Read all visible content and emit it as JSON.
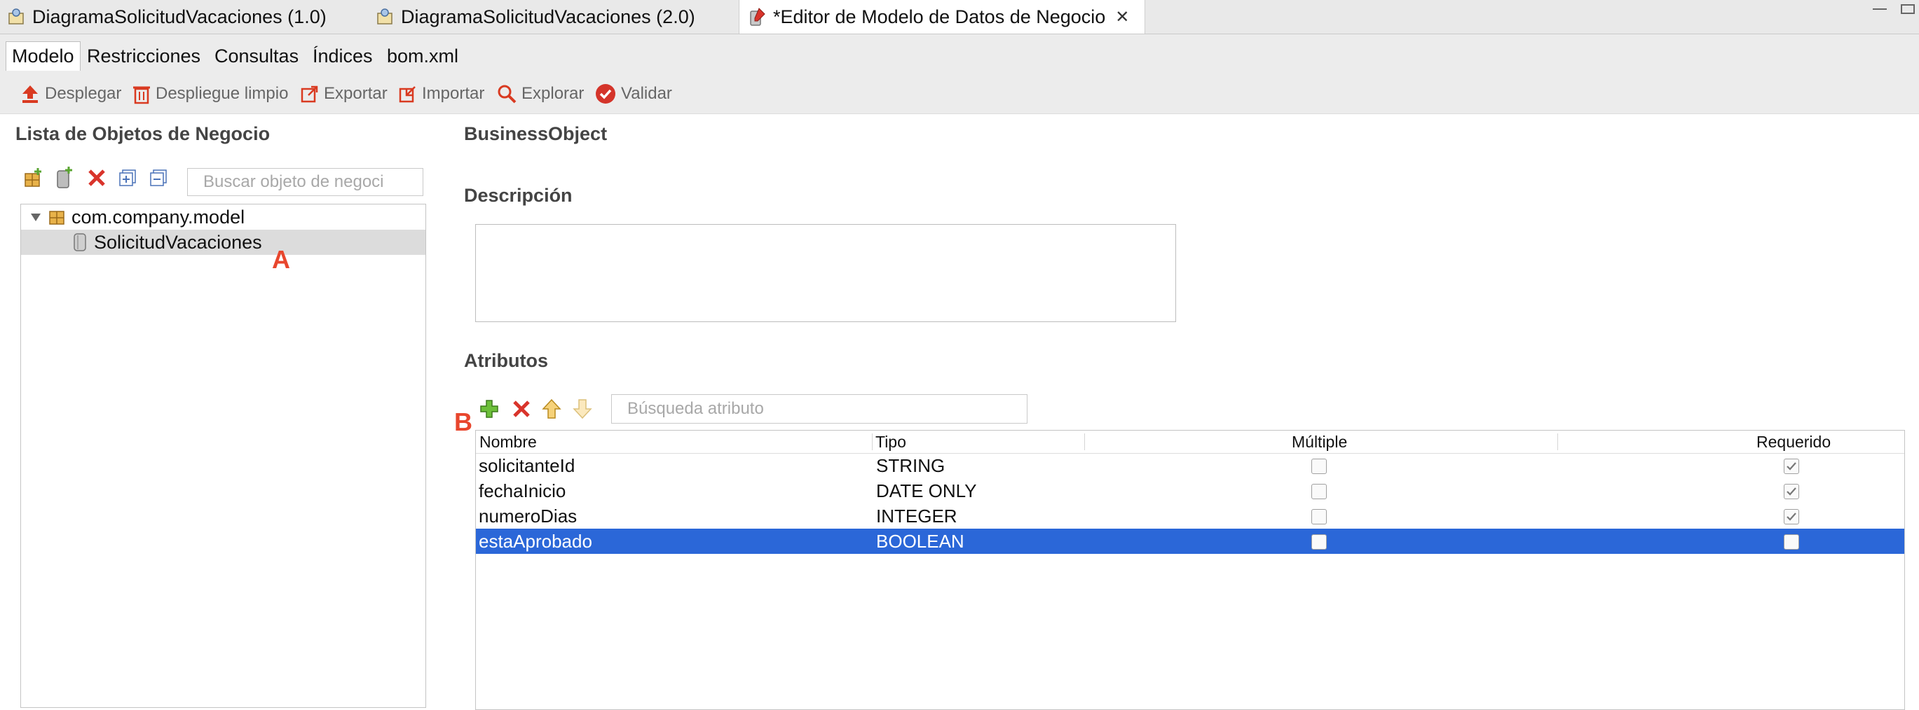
{
  "editor_tabs": [
    {
      "label": "DiagramaSolicitudVacaciones (1.0)"
    },
    {
      "label": "DiagramaSolicitudVacaciones (2.0)"
    },
    {
      "label": "*Editor de Modelo de Datos de Negocio"
    }
  ],
  "page_tabs": [
    {
      "label": "Modelo"
    },
    {
      "label": "Restricciones"
    },
    {
      "label": "Consultas"
    },
    {
      "label": "Índices"
    },
    {
      "label": "bom.xml"
    }
  ],
  "toolbar": {
    "deploy": "Desplegar",
    "clean_deploy": "Despliegue limpio",
    "export": "Exportar",
    "import": "Importar",
    "explore": "Explorar",
    "validate": "Validar"
  },
  "left_panel": {
    "title": "Lista de Objetos de Negocio",
    "search_placeholder": "Buscar objeto de negoci",
    "tree": {
      "package": "com.company.model",
      "object": "SolicitudVacaciones"
    },
    "marker": "A"
  },
  "right_panel": {
    "object_title": "BusinessObject",
    "description_label": "Descripción",
    "description_value": "",
    "attributes_label": "Atributos",
    "attr_search_placeholder": "Búsqueda atributo",
    "marker": "B",
    "table": {
      "headers": {
        "name": "Nombre",
        "type": "Tipo",
        "multiple": "Múltiple",
        "required": "Requerido"
      },
      "rows": [
        {
          "name": "solicitanteId",
          "type": "STRING",
          "multiple": false,
          "required": true
        },
        {
          "name": "fechaInicio",
          "type": "DATE ONLY",
          "multiple": false,
          "required": true
        },
        {
          "name": "numeroDias",
          "type": "INTEGER",
          "multiple": false,
          "required": true
        },
        {
          "name": "estaAprobado",
          "type": "BOOLEAN",
          "multiple": false,
          "required": false,
          "selected": true
        }
      ]
    }
  },
  "colors": {
    "selection": "#2b67d8",
    "marker": "#e8462d",
    "add_green": "#5aa531",
    "delete_red": "#d9342b"
  }
}
